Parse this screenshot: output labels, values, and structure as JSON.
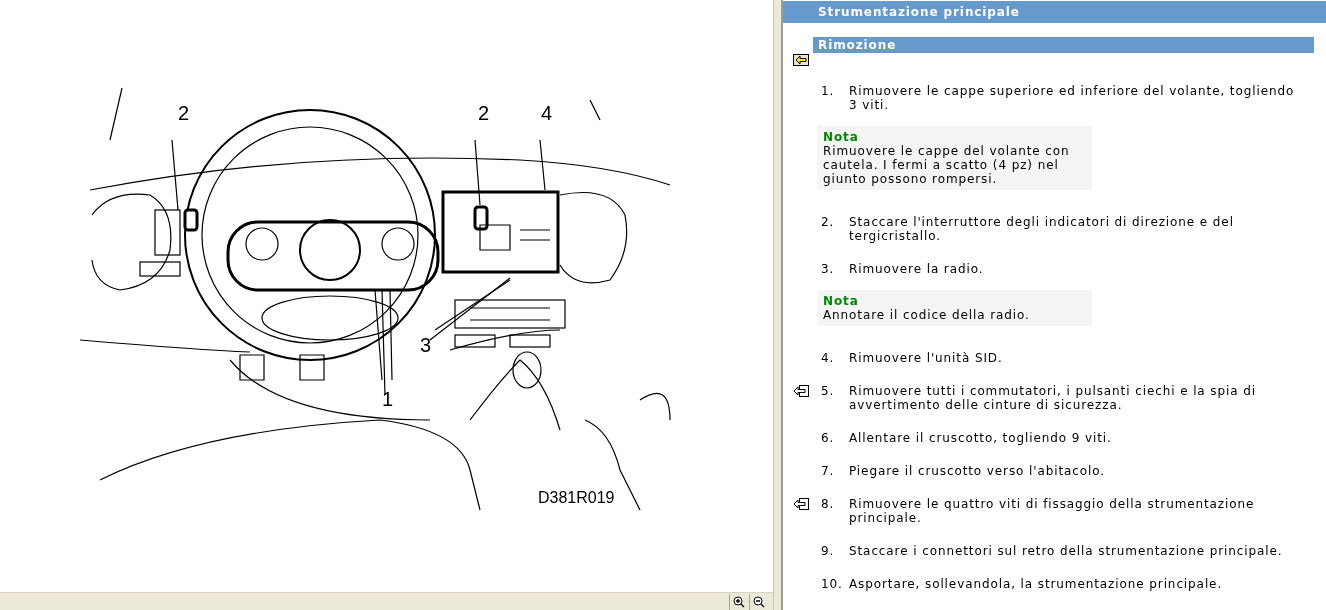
{
  "figure": {
    "callouts": [
      {
        "text": "2"
      },
      {
        "text": "2"
      },
      {
        "text": "4"
      },
      {
        "text": "3"
      },
      {
        "text": "1"
      }
    ],
    "code": "D381R019"
  },
  "document": {
    "title": "Strumentazione principale",
    "section": "Rimozione",
    "items": [
      {
        "kind": "step",
        "number": "1.",
        "text": "Rimuovere le cappe superiore ed inferiore del volante, togliendo 3 viti.",
        "link_icon": false
      },
      {
        "kind": "note",
        "title": "Nota",
        "text": "Rimuovere le cappe del volante con cautela. I fermi a scatto (4 pz) nel giunto possono rompersi."
      },
      {
        "kind": "step",
        "number": "2.",
        "text": "Staccare l'interruttore degli indicatori di direzione e del tergicristallo.",
        "link_icon": false
      },
      {
        "kind": "step",
        "number": "3.",
        "text": "Rimuovere la radio.",
        "link_icon": false
      },
      {
        "kind": "note",
        "title": "Nota",
        "text": "Annotare il codice della radio."
      },
      {
        "kind": "step",
        "number": "4.",
        "text": "Rimuovere l'unità SID.",
        "link_icon": false
      },
      {
        "kind": "step",
        "number": "5.",
        "text": "Rimuovere tutti i commutatori, i pulsanti ciechi e la spia di avvertimento delle cinture di sicurezza.",
        "link_icon": true
      },
      {
        "kind": "step",
        "number": "6.",
        "text": "Allentare il cruscotto, togliendo 9 viti.",
        "link_icon": false
      },
      {
        "kind": "step",
        "number": "7.",
        "text": "Piegare il cruscotto verso l'abitacolo.",
        "link_icon": false
      },
      {
        "kind": "step",
        "number": "8.",
        "text": "Rimuovere le quattro viti di fissaggio della strumentazione principale.",
        "link_icon": true
      },
      {
        "kind": "step",
        "number": "9.",
        "text": "Staccare i connettori sul retro della strumentazione principale.",
        "link_icon": false
      },
      {
        "kind": "step",
        "number": "10.",
        "text": "Asportare, sollevandola, la strumentazione principale.",
        "link_icon": false
      }
    ]
  }
}
